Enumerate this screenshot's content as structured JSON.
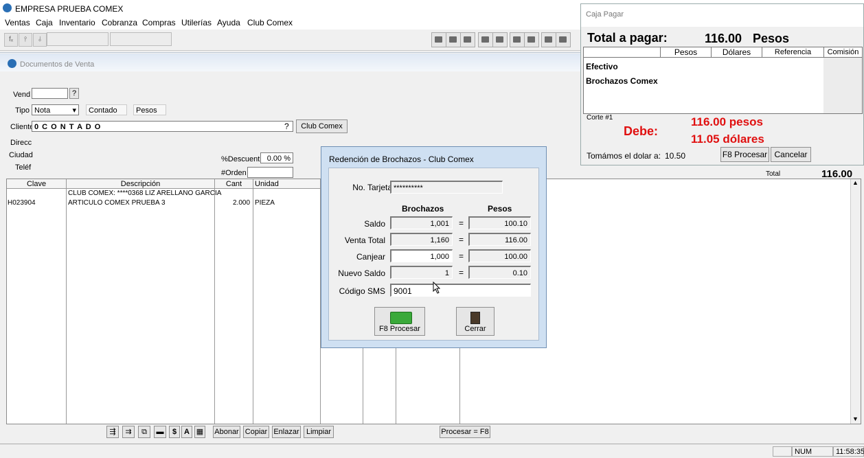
{
  "app": {
    "title": "EMPRESA PRUEBA COMEX"
  },
  "menu": {
    "items": [
      "Ventas",
      "Caja",
      "Inventario",
      "Cobranza",
      "Compras",
      "Utilerías",
      "Ayuda",
      "Club Comex"
    ]
  },
  "toolbar": {
    "fx": "fₓ"
  },
  "doc": {
    "title": "Documentos de Venta",
    "vend_label": "Vend",
    "vend_q": "?",
    "tipo_label": "Tipo",
    "tipo_value": "Nota",
    "pago_value": "Contado",
    "moneda_value": "Pesos",
    "cliente_label": "Cliente",
    "cliente_value": "0 C O N T A D O",
    "cliente_q": "?",
    "club_btn": "Club Comex",
    "direcc_label": "Direcc",
    "ciudad_label": "Ciudad",
    "telef_label": "Teléf",
    "descuento_label": "%Descuent",
    "descuento_value": "0.00 %",
    "orden_label": "#Orden",
    "total_label": "Total",
    "total_value": "116.00"
  },
  "grid": {
    "headers": [
      "Clave",
      "Descripción",
      "Cant",
      "Unidad"
    ],
    "rows": [
      {
        "clave": "",
        "descripcion": "CLUB COMEX: ****0368 LIZ ARELLANO GARCIA",
        "cant": "",
        "unidad": ""
      },
      {
        "clave": "H023904",
        "descripcion": "ARTICULO COMEX PRUEBA 3",
        "cant": "2.000",
        "unidad": "PIEZA"
      }
    ]
  },
  "bottom": {
    "abonar": "Abonar",
    "copiar": "Copiar",
    "enlazar": "Enlazar",
    "limpiar": "Limpiar",
    "procesar": "Procesar = F8",
    "dollar": "$",
    "a": "A"
  },
  "status": {
    "num": "NUM",
    "time": "11:58:35"
  },
  "caja": {
    "title": "Caja Pagar",
    "total_label": "Total a pagar:",
    "total_value": "116.00",
    "total_currency": "Pesos",
    "headers": [
      "Pesos",
      "Dólares",
      "Referencia",
      "Comisión"
    ],
    "rows": [
      "Efectivo",
      "Brochazos Comex"
    ],
    "corte": "Corte #1",
    "debe_label": "Debe:",
    "debe_pesos": "116.00 pesos",
    "debe_dolares": "11.05 dólares",
    "dolar_label": "Tomámos el dolar a:",
    "dolar_value": "10.50",
    "procesar_btn": "F8 Procesar",
    "cancelar_btn": "Cancelar"
  },
  "dialog": {
    "title": "Redención de Brochazos - Club Comex",
    "tarjeta_label": "No. Tarjeta",
    "tarjeta_value": "**********",
    "col_brochazos": "Brochazos",
    "col_pesos": "Pesos",
    "rows": [
      {
        "label": "Saldo",
        "brochazos": "1,001",
        "pesos": "100.10"
      },
      {
        "label": "Venta Total",
        "brochazos": "1,160",
        "pesos": "116.00"
      },
      {
        "label": "Canjear",
        "brochazos": "1,000",
        "pesos": "100.00"
      },
      {
        "label": "Nuevo Saldo",
        "brochazos": "1",
        "pesos": "0.10"
      }
    ],
    "eq": "=",
    "sms_label": "Código SMS",
    "sms_value": "9001",
    "procesar_btn": "F8 Procesar",
    "cerrar_btn": "Cerrar"
  },
  "colors": {
    "red": "#e01010",
    "accent": "#2a6fb5"
  }
}
